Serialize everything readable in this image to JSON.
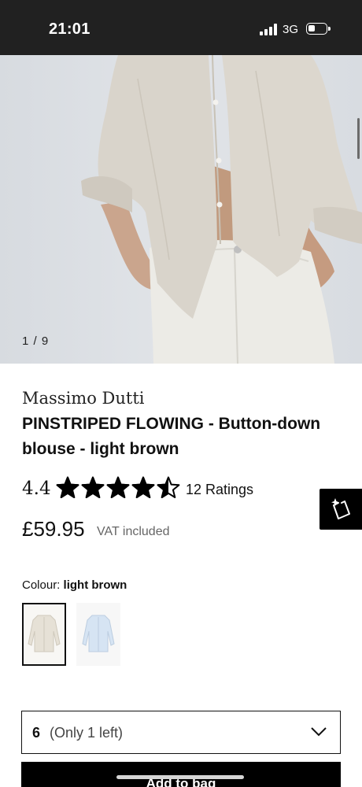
{
  "status_bar": {
    "time": "21:01",
    "network": "3G",
    "icons": [
      "signal-icon",
      "battery-icon"
    ]
  },
  "gallery": {
    "counter": "1 / 9",
    "current_image": 1,
    "total_images": 9
  },
  "product": {
    "brand": "Massimo Dutti",
    "title": "PINSTRIPED FLOWING - Button-down blouse - light brown",
    "rating": "4.4",
    "rating_value": 4.4,
    "rating_max": 5,
    "ratings_count_label": "12 Ratings",
    "price": "£59.95",
    "vat_note": "VAT included"
  },
  "colour": {
    "label": "Colour:",
    "selected": "light brown",
    "swatches": [
      {
        "name": "light brown",
        "selected": true,
        "color": "#e6e1d6"
      },
      {
        "name": "light blue",
        "selected": false,
        "color": "#d6e4f3"
      }
    ]
  },
  "size_select": {
    "value": "6",
    "note": "(Only 1 left)",
    "icon": "chevron-down-icon"
  },
  "actions": {
    "add_to_bag": "Add to bag",
    "share_icon": "share-sparkle-icon"
  },
  "colors": {
    "status_bar_bg": "#212121",
    "primary_button_bg": "#000000",
    "star_fill": "#000000",
    "muted_text": "#666666"
  }
}
